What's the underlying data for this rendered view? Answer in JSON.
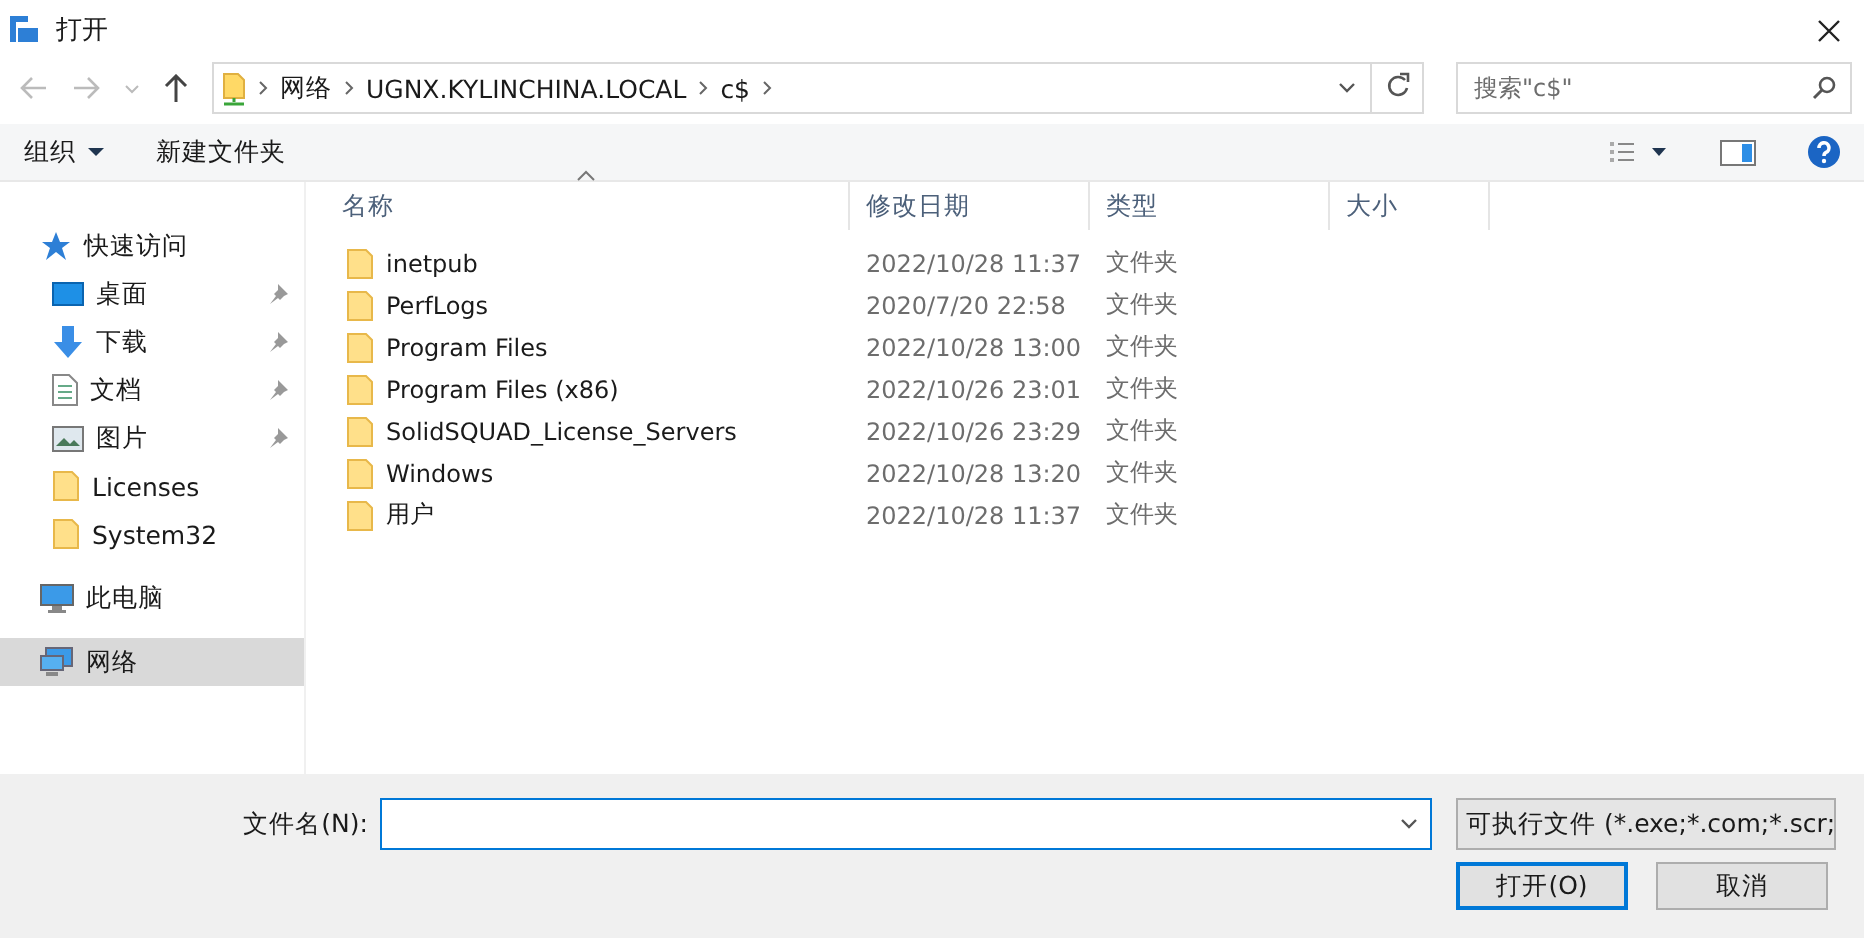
{
  "window": {
    "title": "打开"
  },
  "breadcrumb": [
    "网络",
    "UGNX.KYLINCHINA.LOCAL",
    "c$"
  ],
  "search": {
    "placeholder": "搜索\"c$\""
  },
  "toolbar": {
    "organize": "组织",
    "new_folder": "新建文件夹"
  },
  "sidebar": {
    "items": [
      {
        "kind": "quick-access",
        "label": "快速访问",
        "pinned": false,
        "selected": false
      },
      {
        "kind": "desktop",
        "label": "桌面",
        "pinned": true,
        "selected": false
      },
      {
        "kind": "downloads",
        "label": "下载",
        "pinned": true,
        "selected": false
      },
      {
        "kind": "documents",
        "label": "文档",
        "pinned": true,
        "selected": false
      },
      {
        "kind": "pictures",
        "label": "图片",
        "pinned": true,
        "selected": false
      },
      {
        "kind": "folder",
        "label": "Licenses",
        "pinned": false,
        "selected": false
      },
      {
        "kind": "folder",
        "label": "System32",
        "pinned": false,
        "selected": false
      },
      {
        "kind": "computer",
        "label": "此电脑",
        "pinned": false,
        "selected": false
      },
      {
        "kind": "network",
        "label": "网络",
        "pinned": false,
        "selected": true
      }
    ]
  },
  "table": {
    "columns": [
      "名称",
      "修改日期",
      "类型",
      "大小"
    ],
    "rows": [
      {
        "name": "inetpub",
        "modified": "2022/10/28 11:37",
        "type": "文件夹"
      },
      {
        "name": "PerfLogs",
        "modified": "2020/7/20 22:58",
        "type": "文件夹"
      },
      {
        "name": "Program Files",
        "modified": "2022/10/28 13:00",
        "type": "文件夹"
      },
      {
        "name": "Program Files (x86)",
        "modified": "2022/10/26 23:01",
        "type": "文件夹"
      },
      {
        "name": "SolidSQUAD_License_Servers",
        "modified": "2022/10/26 23:29",
        "type": "文件夹"
      },
      {
        "name": "Windows",
        "modified": "2022/10/28 13:20",
        "type": "文件夹"
      },
      {
        "name": "用户",
        "modified": "2022/10/28 11:37",
        "type": "文件夹"
      }
    ]
  },
  "footer": {
    "filename_label": "文件名(N):",
    "file_type": "可执行文件 (*.exe;*.com;*.scr;",
    "buttons": [
      {
        "label": "打开(O)",
        "default": true
      },
      {
        "label": "取消",
        "default": false
      }
    ]
  }
}
